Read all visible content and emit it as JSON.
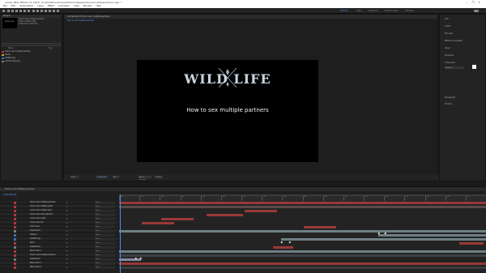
{
  "app": {
    "window_title": "Adobe After Effects CC 2018 - D:\\wildlife\\videos\\wildlife\\multiplepartners\\multiplepartners.aep *",
    "window_buttons": [
      "—",
      "❐",
      "✕"
    ]
  },
  "menu": [
    "File",
    "Edit",
    "Composition",
    "Layer",
    "Effect",
    "Animation",
    "View",
    "Window",
    "Help"
  ],
  "workspaces": [
    "Default",
    "Learn",
    "Standard",
    "Small Screen",
    "Libraries"
  ],
  "project": {
    "panel_title": "Project",
    "thumb_text": "WILD LIFE",
    "info": "How to sex multiple partners\n1920 x 1080 (1.00)\n0;00;17;14, 29.97 fps",
    "search_placeholder": "",
    "columns": [
      "Name",
      "Type"
    ],
    "items": [
      {
        "name": "How to sex multiple partners",
        "color": "#b3373c"
      },
      {
        "name": "Solids",
        "color": "#c7a02a"
      },
      {
        "name": "wildlife logo",
        "color": "#3a6fb0"
      },
      {
        "name": "wild life logo.png",
        "color": "#7a7a7a"
      }
    ]
  },
  "viewer": {
    "tab_label": "Composition How to sex multiple partners",
    "sub_label": "How to sex multiple partners",
    "logo_text": "WILD LIFE",
    "subtitle": "How to sex multiple partners",
    "zoom": "25%",
    "timecode": "0;00;00;00",
    "quality": "Full",
    "camera": "Active Camera",
    "views": "1 View"
  },
  "right_panel": {
    "items": [
      "Info",
      "Audio",
      "Preview",
      "Effects & Presets",
      "Align",
      "Libraries",
      "Character",
      "Paragraph",
      "Tracker"
    ],
    "font": "Regular"
  },
  "timeline": {
    "tab_label": "How to sex multiple partners",
    "timecode": "0;00;00;00",
    "ruler_ticks": [
      "00s",
      "01s",
      "02s",
      "03s",
      "04s",
      "05s",
      "06s",
      "07s",
      "08s",
      "09s",
      "10s",
      "11s",
      "12s",
      "13s",
      "14s",
      "15s",
      "16s",
      "17s"
    ],
    "layers": [
      {
        "name": "How to sex multiple partners",
        "label": "#b3373c",
        "parent": "None"
      },
      {
        "name": "how to sex multiple parts",
        "label": "#b3373c",
        "parent": "None"
      },
      {
        "name": "how to sex multiple part",
        "label": "#b3373c",
        "parent": "None"
      },
      {
        "name": "how to sex multi partners",
        "label": "#b3373c",
        "parent": "None"
      },
      {
        "name": "how to sex multip",
        "label": "#b3373c",
        "parent": "None"
      },
      {
        "name": "how to sex mul",
        "label": "#b3373c",
        "parent": "None"
      },
      {
        "name": "how to sex",
        "label": "#b3373c",
        "parent": "None"
      },
      {
        "name": "Adjustment",
        "label": "#7a7a7a",
        "parent": "None"
      },
      {
        "name": "Shape 1",
        "label": "#3a6fb0",
        "parent": "None"
      },
      {
        "name": "wildlife logo",
        "label": "#3a6fb0",
        "parent": "None"
      },
      {
        "name": "Null 1",
        "label": "#b3373c",
        "parent": "None"
      },
      {
        "name": "Adjustment",
        "label": "#7a7a7a",
        "parent": "None"
      },
      {
        "name": "Black Solid 1",
        "label": "#b3373c",
        "parent": "None"
      },
      {
        "name": "How to sex multiple partners",
        "label": "#b3373c",
        "parent": "None"
      },
      {
        "name": "Adjustment",
        "label": "#7a7a7a",
        "parent": "None"
      },
      {
        "name": "Black Solid 1",
        "label": "#b3373c",
        "parent": "None"
      },
      {
        "name": "Black Solid 2",
        "label": "#b3373c",
        "parent": "None"
      }
    ]
  },
  "colors": {
    "accent": "#4d8fe0",
    "clip_red": "#9a3838",
    "clip_gray": "#6f7f83",
    "playhead": "#3f8fff"
  }
}
